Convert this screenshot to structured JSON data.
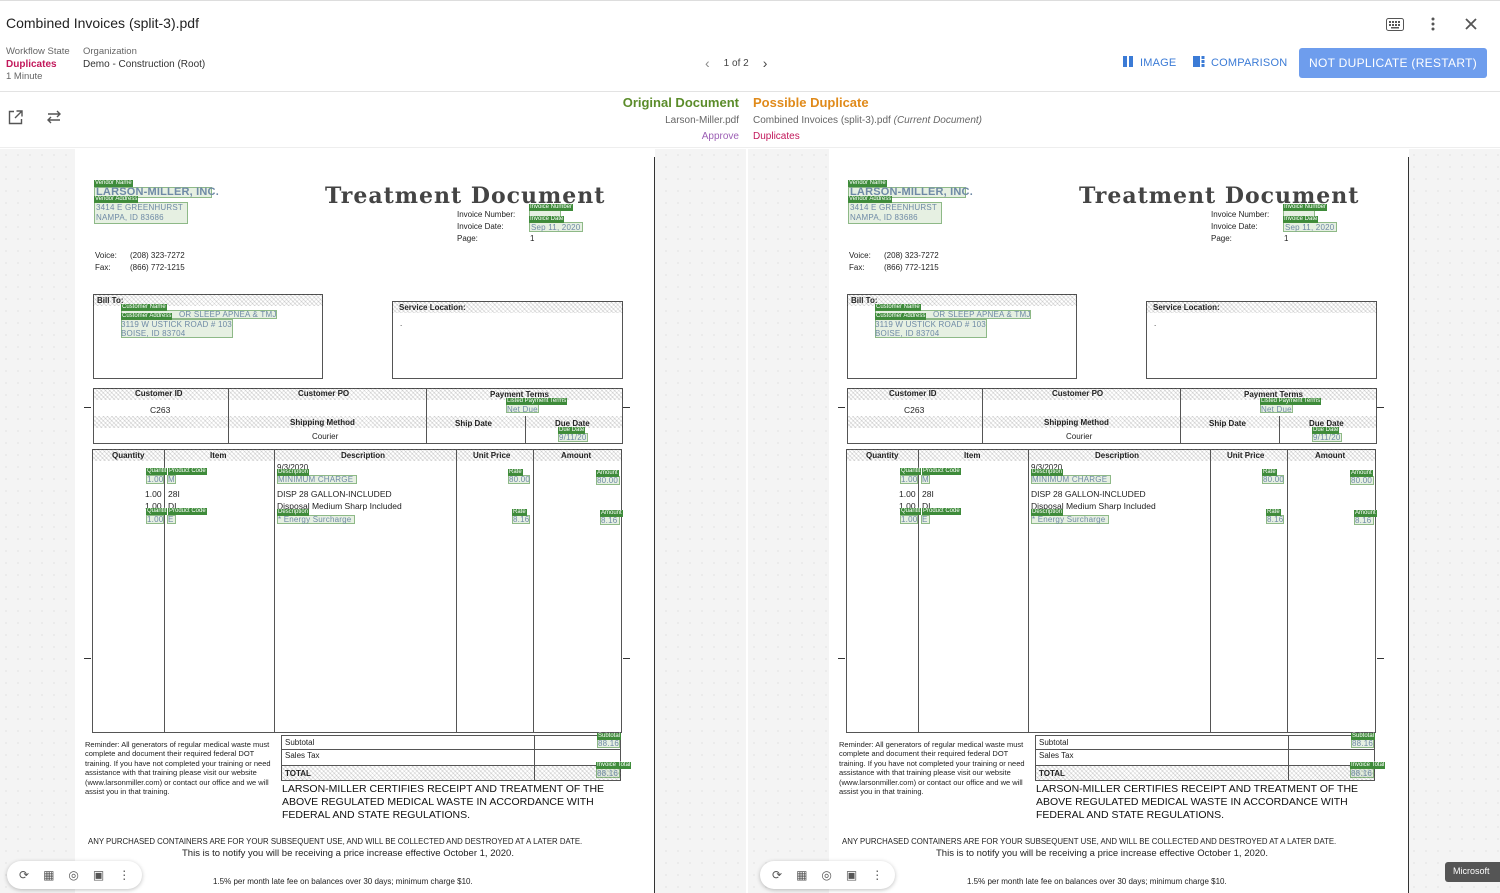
{
  "window": {
    "title": "Combined Invoices (split-3).pdf"
  },
  "meta": {
    "workflow_state_label": "Workflow State",
    "workflow_state_value": "Duplicates",
    "workflow_state_time": "1 Minute",
    "organization_label": "Organization",
    "organization_value": "Demo - Construction (Root)"
  },
  "pager": {
    "text": "1 of 2"
  },
  "views": {
    "image": "IMAGE",
    "comparison": "COMPARISON"
  },
  "actions": {
    "primary": "NOT DUPLICATE (RESTART)"
  },
  "original": {
    "heading": "Original Document",
    "file": "Larson-Miller.pdf",
    "status": "Approve"
  },
  "duplicate": {
    "heading": "Possible Duplicate",
    "file": "Combined Invoices (split-3).pdf",
    "file_note": "(Current Document)",
    "status": "Duplicates"
  },
  "invoice": {
    "vendor_name": "LARSON-MILLER, INC.",
    "vendor_addr1": "3414 E GREENHURST",
    "vendor_addr2": "NAMPA, ID 83686",
    "doc_title": "Treatment Document",
    "invoice_number_label": "Invoice Number:",
    "invoice_date_label": "Invoice Date:",
    "invoice_date": "Sep 11, 2020",
    "page_label": "Page:",
    "page_value": "1",
    "voice_label": "Voice:",
    "voice": "(208) 323-7272",
    "fax_label": "Fax:",
    "fax": "(866) 772-1215",
    "bill_to_label": "Bill To:",
    "customer_name": "OR SLEEP APNEA & TMJ",
    "customer_addr1": "3119 W USTICK ROAD # 103",
    "customer_addr2": "BOISE, ID 83704",
    "service_location_label": "Service Location:",
    "service_location_value": ".",
    "customer_id_label": "Customer ID",
    "customer_id": "C263",
    "customer_po_label": "Customer PO",
    "payment_terms_label": "Payment Terms",
    "payment_terms": "Net Due",
    "shipping_method_label": "Shipping Method",
    "shipping_method": "Courier",
    "ship_date_label": "Ship Date",
    "due_date_label": "Due Date",
    "due_date": "9/11/20",
    "col_quantity": "Quantity",
    "col_item": "Item",
    "col_description": "Description",
    "col_unit_price": "Unit Price",
    "col_amount": "Amount",
    "line_date": "9/3/2020",
    "lines": [
      {
        "qty": "1.00",
        "item": "M",
        "desc": "MINIMUM CHARGE",
        "rate": "80.00",
        "amount": "80.00"
      },
      {
        "qty": "1.00",
        "item": "28I",
        "desc": "DISP 28 GALLON-INCLUDED",
        "rate": "",
        "amount": ""
      },
      {
        "qty": "1.00",
        "item": "DI",
        "desc": "Disposal Medium Sharp Included",
        "rate": "",
        "amount": ""
      },
      {
        "qty": "1.00",
        "item": "E",
        "desc": "* Energy Surcharge",
        "rate": "8.16",
        "amount": "8.16"
      }
    ],
    "reminder": "Reminder: All generators of regular medical waste must complete and document their required federal DOT training. If you have not completed your training or need assistance with that training please visit our website (www.larsonmiller.com) or contact our office and we will assist you in that training.",
    "subtotal_label": "Subtotal",
    "subtotal": "88.16",
    "sales_tax_label": "Sales Tax",
    "total_label": "TOTAL",
    "total": "88.16",
    "certify": "LARSON-MILLER CERTIFIES RECEIPT AND TREATMENT OF THE ABOVE REGULATED MEDICAL WASTE IN ACCORDANCE WITH FEDERAL AND STATE REGULATIONS.",
    "purchased": "ANY PURCHASED CONTAINERS ARE FOR YOUR SUBSEQUENT USE, AND WILL BE COLLECTED AND DESTROYED AT A LATER DATE.",
    "notify": "This is to notify you will be receiving a price increase effective October 1, 2020.",
    "late_fee": "1.5% per month late fee on balances over 30 days; minimum charge $10."
  },
  "tags": {
    "vendor_name": "Vendor Name",
    "vendor_address": "Vendor Address",
    "invoice_number": "Invoice Number",
    "invoice_date": "Invoice Date",
    "customer_name": "Customer Name",
    "customer_address": "Customer Address",
    "listed_payment_terms": "Listed Payment Terms",
    "due_date": "Due Date",
    "quantity": "Quantit",
    "product_code": "Product Code",
    "description": "Description",
    "rate": "Rate",
    "amount": "Amount",
    "subtotal": "Subtotal",
    "invoice_total": "Invoice Total"
  },
  "footer": {
    "microsoft": "Microsoft"
  },
  "colors": {
    "accent": "#3b7bd6",
    "primary_button": "#6e9ded",
    "original": "#5b8c2a",
    "duplicate": "#e08a1a",
    "duplicates_state": "#c2185b",
    "highlight": "#3e8b3a"
  }
}
